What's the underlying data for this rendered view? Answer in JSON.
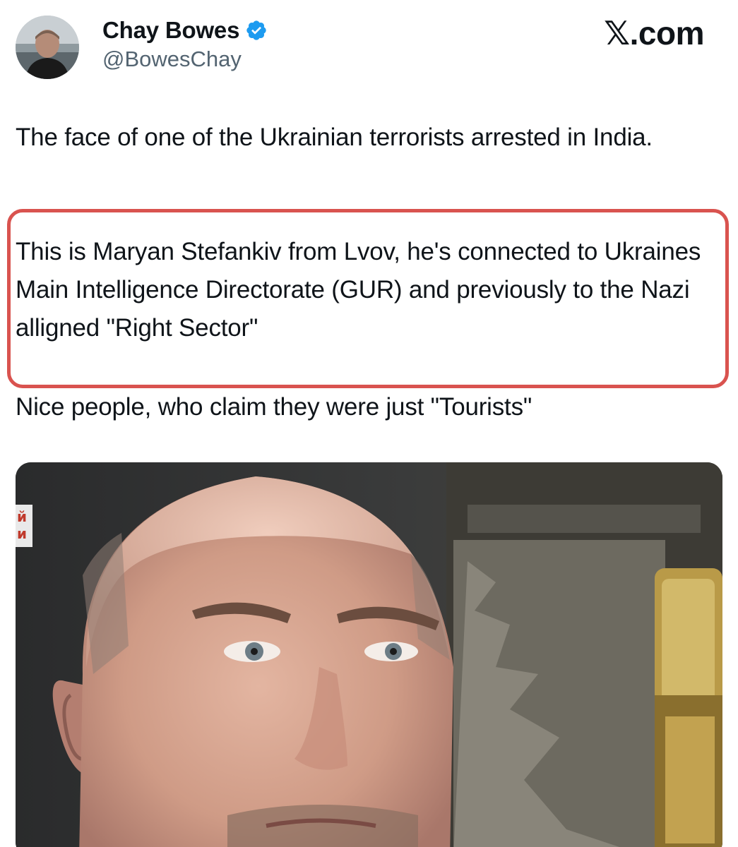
{
  "author": {
    "display_name": "Chay Bowes",
    "handle": "@BowesChay",
    "verified_icon": "verified-badge-icon",
    "verified_color": "#1d9bf0"
  },
  "brand": {
    "label": "𝕏.com"
  },
  "tweet": {
    "paragraph_1": "The face of one of the Ukrainian terrorists arrested in India.",
    "paragraph_2": "This is Maryan Stefankiv from Lvov, he's connected to Ukraines Main Intelligence Directorate (GUR) and previously to the Nazi alligned \"Right Sector\"",
    "paragraph_3": "Nice people, who claim they were just \"Tourists\""
  },
  "media": {
    "corner_text": "й\nи"
  },
  "colors": {
    "highlight_border": "#d9534f",
    "text": "#0f1419",
    "secondary_text": "#536471"
  }
}
